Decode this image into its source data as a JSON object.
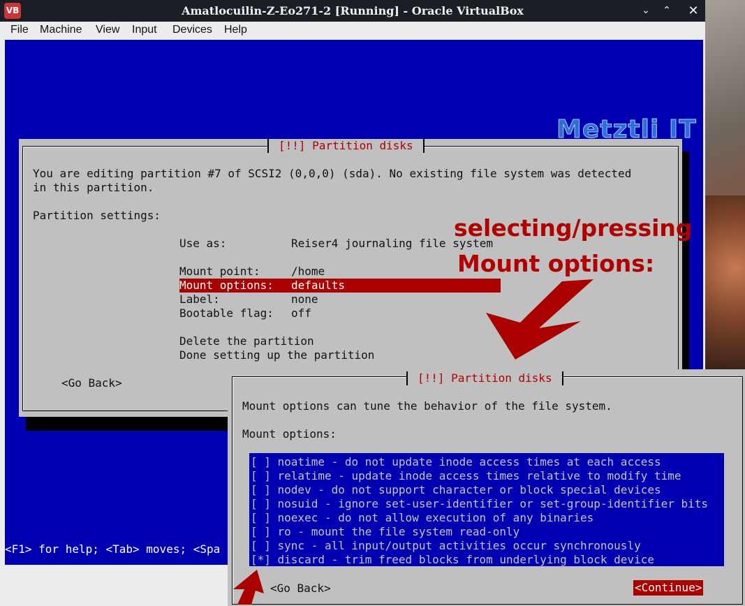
{
  "window": {
    "title": "Amatlocuilin-Z-Eo271-2 [Running] - Oracle VirtualBox",
    "app_icon_text": "VB"
  },
  "titlebar_buttons": {
    "minimize": "⌄",
    "maximize": "⌃",
    "close": "✕"
  },
  "menu": [
    "File",
    "Machine",
    "View",
    "Input",
    "Devices",
    "Help"
  ],
  "logo": "Metztli IT",
  "dialog1": {
    "title": "[!!] Partition disks",
    "intro_line1": "You are editing partition #7 of SCSI2 (0,0,0) (sda). No existing file system was detected",
    "intro_line2": "in this partition.",
    "section_label": "Partition settings:",
    "use_as_label": "Use as:",
    "use_as_value": "Reiser4 journaling file system",
    "mount_point_label": "Mount point:",
    "mount_point_value": "/home",
    "mount_options_label": "Mount options:",
    "mount_options_value": "defaults",
    "label_label": "Label:",
    "label_value": "none",
    "bootable_label": "Bootable flag:",
    "bootable_value": "off",
    "delete": "Delete the partition",
    "done": "Done setting up the partition",
    "go_back": "<Go Back>"
  },
  "help_line": "<F1> for help; <Tab> moves; <Spa",
  "dialog2": {
    "title": "[!!] Partition disks",
    "intro": "Mount options can tune the behavior of the file system.",
    "section_label": "Mount options:",
    "options": [
      "[ ] noatime - do not update inode access times at each access",
      "[ ] relatime - update inode access times relative to modify time",
      "[ ] nodev - do not support character or block special devices",
      "[ ] nosuid - ignore set-user-identifier or set-group-identifier bits",
      "[ ] noexec - do not allow execution of any binaries",
      "[ ] ro - mount the file system read-only",
      "[ ] sync - all input/output activities occur synchronously",
      "[*] discard - trim freed blocks from underlying block device"
    ],
    "go_back": "<Go Back>",
    "continue": "<Continue>"
  },
  "annotation": {
    "line1": "selecting/pressing",
    "line2": "Mount options:"
  },
  "colors": {
    "vm_background": "#0000b2",
    "dialog": "#c0c0c0",
    "highlight": "#aa0000",
    "annotation": "#b00000"
  }
}
